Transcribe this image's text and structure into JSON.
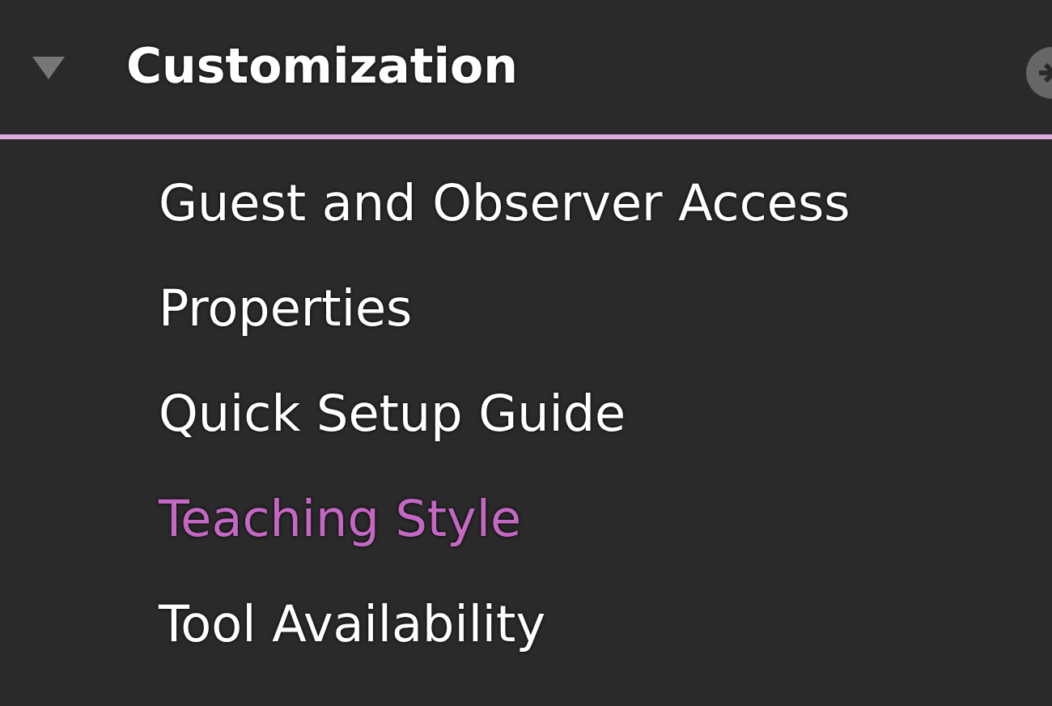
{
  "section": {
    "title": "Customization",
    "expanded": true
  },
  "items": [
    {
      "label": "Guest and Observer Access",
      "selected": false
    },
    {
      "label": "Properties",
      "selected": false
    },
    {
      "label": "Quick Setup Guide",
      "selected": false
    },
    {
      "label": "Teaching Style",
      "selected": true
    },
    {
      "label": "Tool Availability",
      "selected": false
    }
  ]
}
